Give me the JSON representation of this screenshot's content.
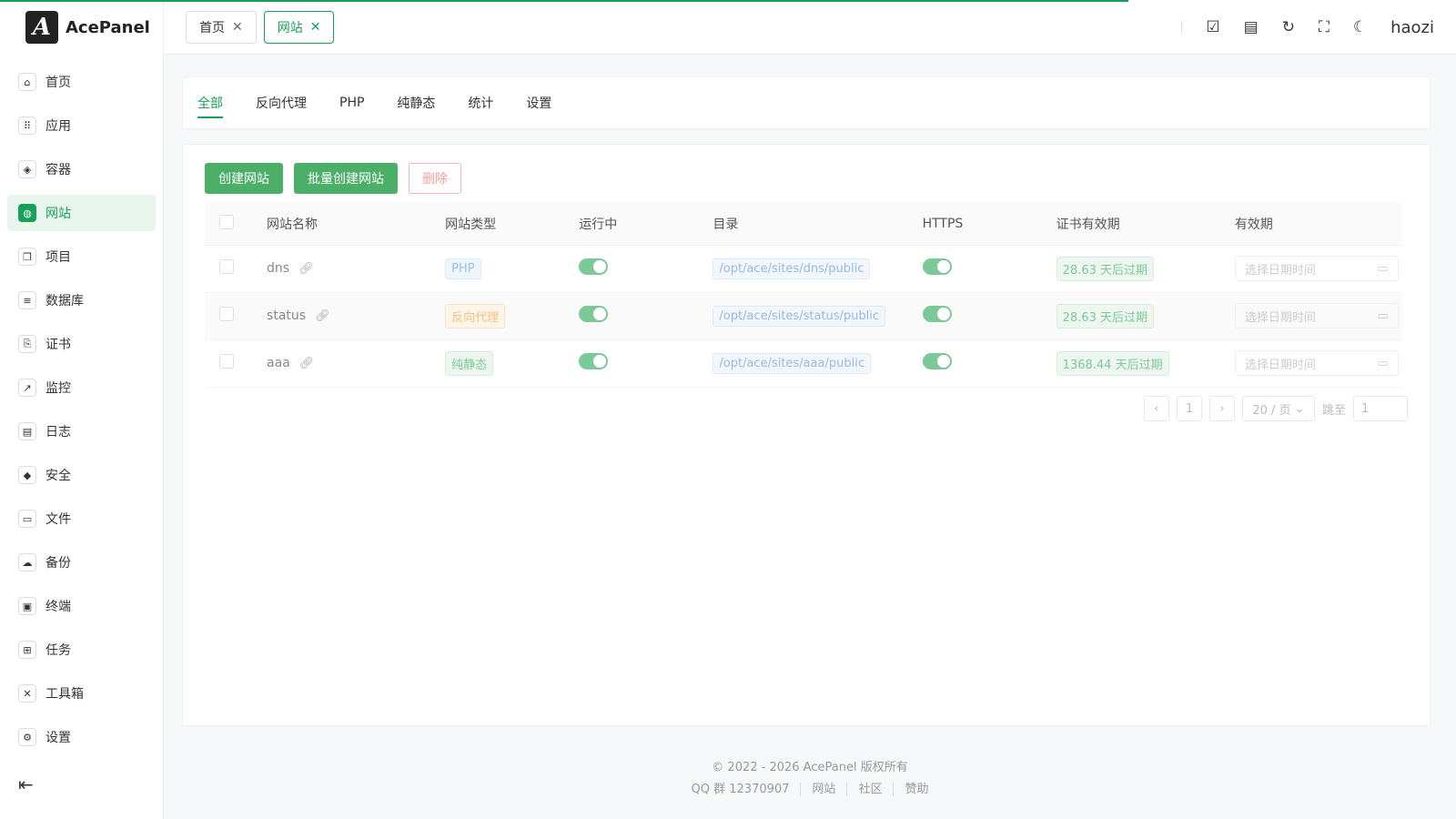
{
  "app": {
    "name": "AcePanel",
    "logo_glyph": "A"
  },
  "colors": {
    "accent": "#18a058"
  },
  "sidebar": {
    "items": [
      {
        "label": "首页",
        "icon": "home-icon",
        "glyph": "⌂"
      },
      {
        "label": "应用",
        "icon": "apps-icon",
        "glyph": "⠿"
      },
      {
        "label": "容器",
        "icon": "layers-icon",
        "glyph": "◈"
      },
      {
        "label": "网站",
        "icon": "globe-icon",
        "glyph": "◍"
      },
      {
        "label": "项目",
        "icon": "project-icon",
        "glyph": "❐"
      },
      {
        "label": "数据库",
        "icon": "database-icon",
        "glyph": "≡"
      },
      {
        "label": "证书",
        "icon": "certificate-icon",
        "glyph": "⎘"
      },
      {
        "label": "监控",
        "icon": "chart-icon",
        "glyph": "↗"
      },
      {
        "label": "日志",
        "icon": "log-icon",
        "glyph": "▤"
      },
      {
        "label": "安全",
        "icon": "shield-icon",
        "glyph": "◆"
      },
      {
        "label": "文件",
        "icon": "folder-icon",
        "glyph": "▭"
      },
      {
        "label": "备份",
        "icon": "cloud-icon",
        "glyph": "☁"
      },
      {
        "label": "终端",
        "icon": "terminal-icon",
        "glyph": "▣"
      },
      {
        "label": "任务",
        "icon": "task-icon",
        "glyph": "⊞"
      },
      {
        "label": "工具箱",
        "icon": "tools-icon",
        "glyph": "✕"
      },
      {
        "label": "设置",
        "icon": "gear-icon",
        "glyph": "⚙"
      }
    ],
    "active_index": 3
  },
  "header": {
    "tabs": [
      {
        "label": "首页"
      },
      {
        "label": "网站"
      }
    ],
    "user": "haozi"
  },
  "subtabs": [
    "全部",
    "反向代理",
    "PHP",
    "纯静态",
    "统计",
    "设置"
  ],
  "toolbar": {
    "create": "创建网站",
    "batch_create": "批量创建网站",
    "delete": "删除"
  },
  "table": {
    "headers": [
      "网站名称",
      "网站类型",
      "运行中",
      "目录",
      "HTTPS",
      "证书有效期",
      "有效期"
    ],
    "rows": [
      {
        "name": "dns",
        "type": "PHP",
        "type_color": "blue",
        "path": "/opt/ace/sites/dns/public",
        "cert": "28.63 天后过期",
        "expire_placeholder": "选择日期时间"
      },
      {
        "name": "status",
        "type": "反向代理",
        "type_color": "orange",
        "path": "/opt/ace/sites/status/public",
        "cert": "28.63 天后过期",
        "expire_placeholder": "选择日期时间"
      },
      {
        "name": "aaa",
        "type": "纯静态",
        "type_color": "green",
        "path": "/opt/ace/sites/aaa/public",
        "cert": "1368.44 天后过期",
        "expire_placeholder": "选择日期时间"
      }
    ]
  },
  "pagination": {
    "prev": "‹",
    "page": "1",
    "next": "›",
    "page_size": "20 / 页",
    "jump_label": "跳至",
    "jump_value": "1"
  },
  "footer": {
    "copyright": "© 2022 - 2026 AcePanel 版权所有",
    "links": [
      "QQ 群 12370907",
      "网站",
      "社区",
      "赞助"
    ]
  }
}
